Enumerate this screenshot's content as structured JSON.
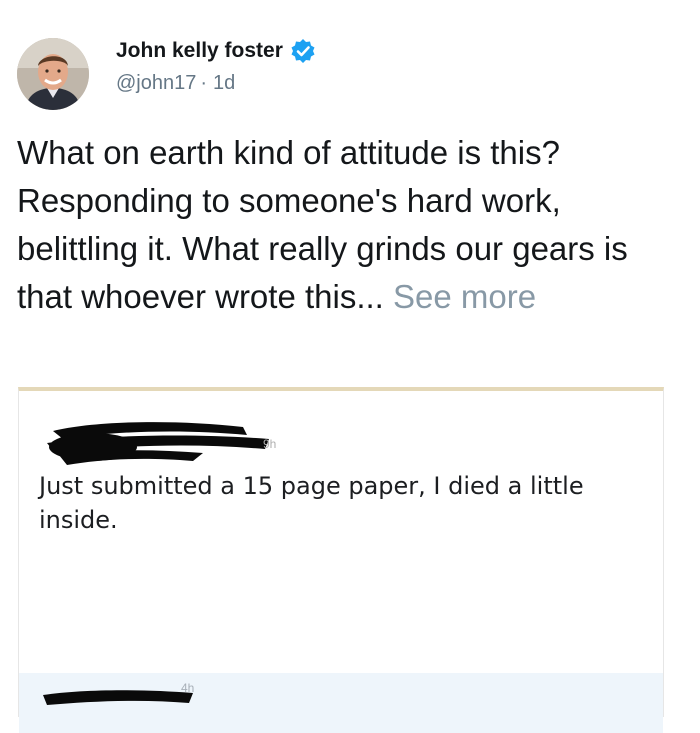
{
  "author": {
    "display_name": "John kelly foster",
    "handle": "@john17",
    "separator": "·",
    "time": "1d",
    "avatar_icon": "person-avatar",
    "verified_icon": "verified-badge-icon",
    "verified_color": "#1da1f2"
  },
  "tweet": {
    "text": "What on earth kind of attitude is this? Responding to someone's hard work, belittling it. What really grinds our gears is that whoever wrote this...",
    "see_more_label": "See more"
  },
  "quoted_post": {
    "time": "9h",
    "text": "Just submitted a 15 page paper, I died a little inside.",
    "next_reply_time": "4h"
  }
}
